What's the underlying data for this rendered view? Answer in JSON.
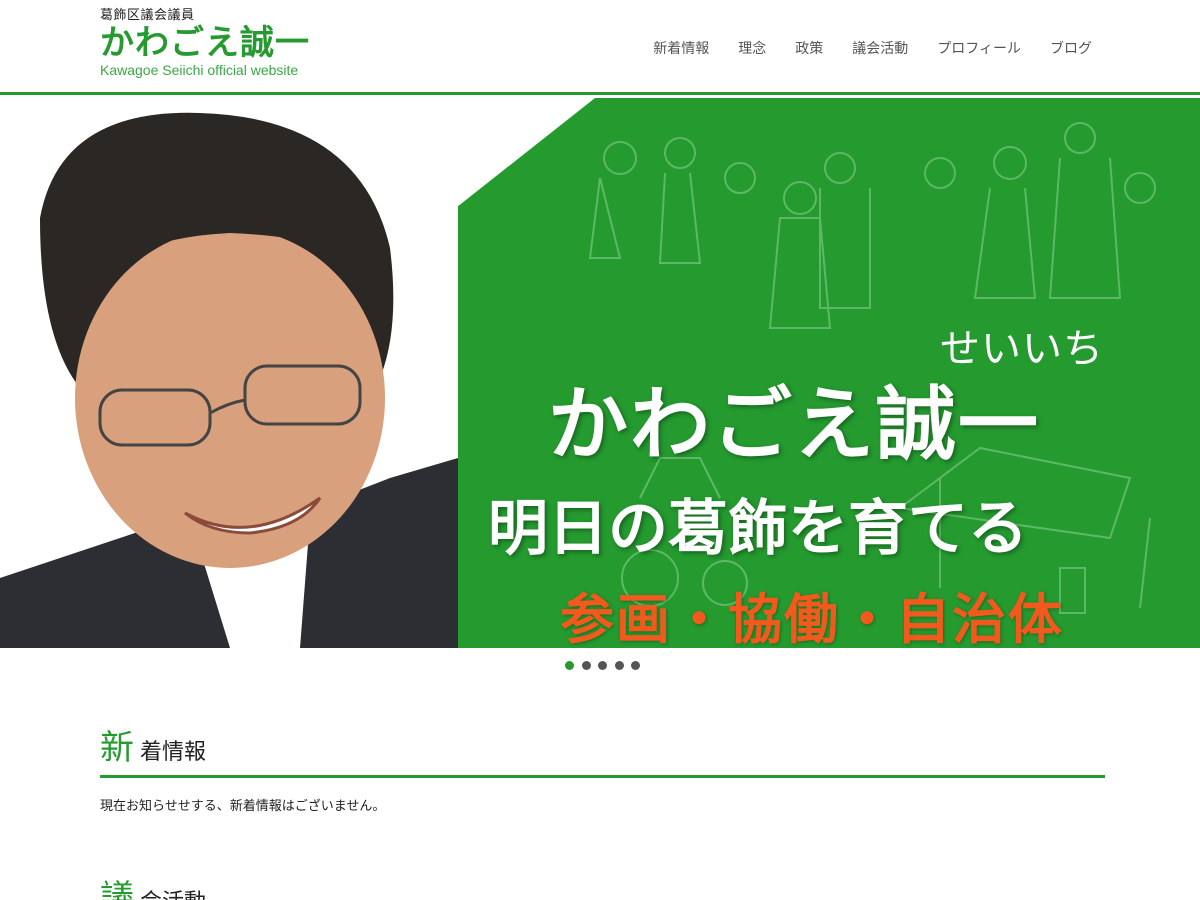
{
  "header": {
    "subtitle": "葛飾区議会議員",
    "name": "かわごえ誠一",
    "english": "Kawagoe Seiichi official website"
  },
  "nav": {
    "items": [
      "新着情報",
      "理念",
      "政策",
      "議会活動",
      "プロフィール",
      "ブログ"
    ]
  },
  "hero": {
    "kana": "せいいち",
    "name": "かわごえ誠一",
    "slogan": "明日の葛飾を育てる",
    "tagline": "参画・協働・自治体"
  },
  "slider": {
    "count": 5,
    "active_index": 0
  },
  "news": {
    "title_first": "新",
    "title_rest": "着情報",
    "message": "現在お知らせせする、新着情報はございません。"
  },
  "activities": {
    "title_first": "議",
    "title_rest": "会活動"
  },
  "colors": {
    "brand_green": "#249a2f",
    "accent_orange": "#f25a1d"
  }
}
